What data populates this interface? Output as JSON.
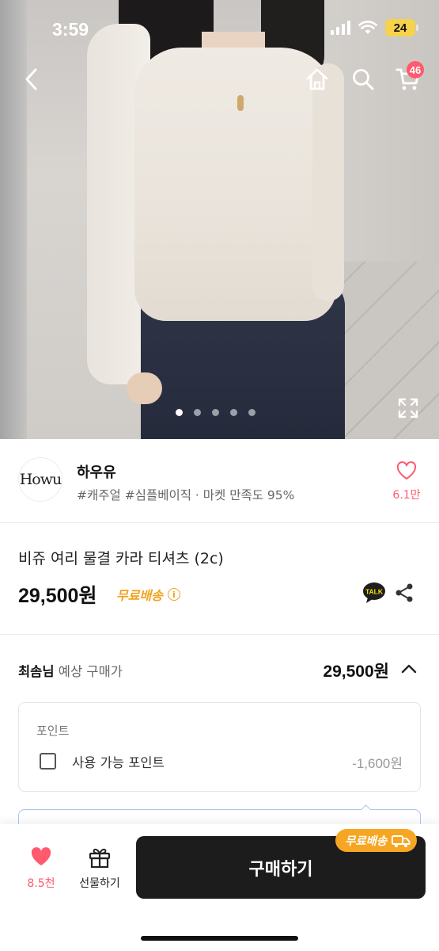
{
  "status_bar": {
    "time": "3:59",
    "battery": "24"
  },
  "nav": {
    "cart_count": "46",
    "icons": [
      "back-icon",
      "home-icon",
      "search-icon",
      "cart-icon"
    ]
  },
  "gallery": {
    "total_images": 5,
    "current_index": 1
  },
  "shop": {
    "logo_text": "Howu",
    "name": "하우유",
    "tags": "#캐주얼 #심플베이직 · 마켓 만족도 95%",
    "like_count": "6.1만"
  },
  "product": {
    "title": "비쥬 여리 물결 카라 티셔츠 (2c)",
    "price": "29,500원",
    "free_shipping": "무료배송",
    "info_icon": "i"
  },
  "estimate": {
    "user_name": "최솜님",
    "label": "예상 구매가",
    "price": "29,500원"
  },
  "points": {
    "title": "포인트",
    "option_label": "사용 가능 포인트",
    "amount": "-1,600원",
    "checked": false
  },
  "bottom_bar": {
    "like_count": "8.5천",
    "gift_label": "선물하기",
    "buy_label": "구매하기",
    "badge_label": "무료배송"
  },
  "colors": {
    "accent_pink": "#ff5a6e",
    "shipping_orange": "#f2a21f",
    "buy_button": "#1c1c1c"
  }
}
